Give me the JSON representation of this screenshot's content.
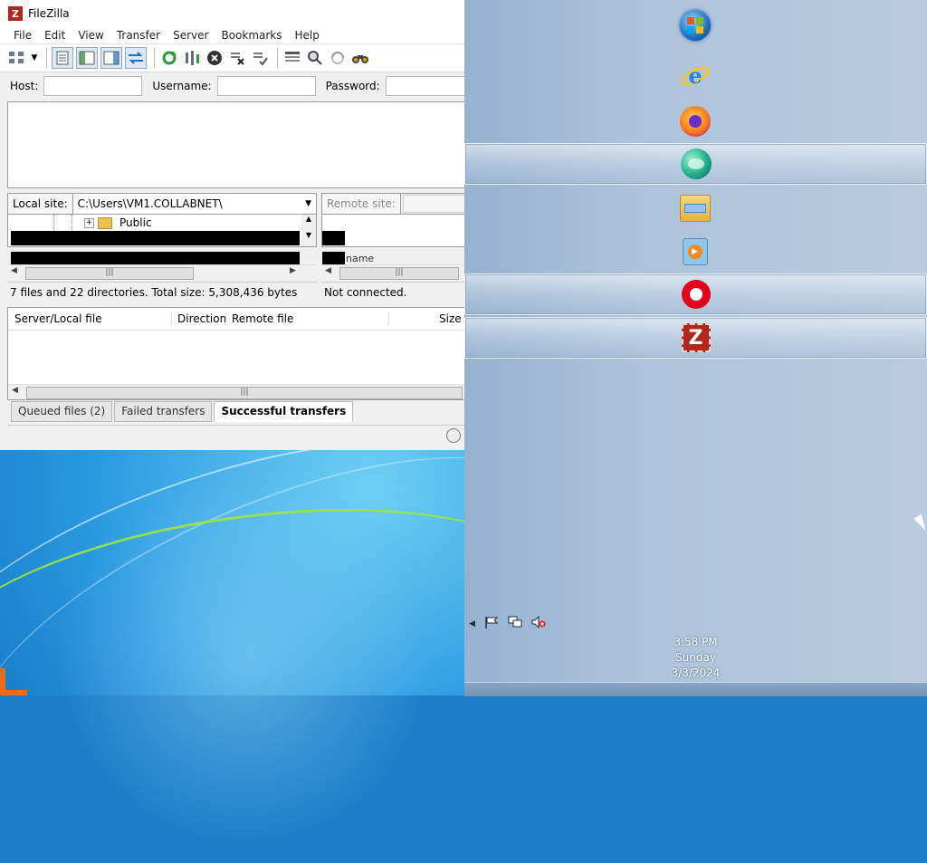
{
  "window": {
    "title": "FileZilla",
    "logo_text": "Z",
    "menu": [
      "File",
      "Edit",
      "View",
      "Transfer",
      "Server",
      "Bookmarks",
      "Help"
    ],
    "quickconnect": {
      "host_label": "Host:",
      "username_label": "Username:",
      "password_label": "Password:",
      "host_value": "",
      "username_value": "",
      "password_value": ""
    },
    "local_site": {
      "label": "Local site:",
      "path": "C:\\Users\\VM1.COLLABNET\\",
      "tree_item": "Public",
      "status": "7 files and 22 directories. Total size: 5,308,436 bytes"
    },
    "remote_site": {
      "label": "Remote site:",
      "column_fragment": "name",
      "status": "Not connected."
    },
    "queue": {
      "columns": [
        "Server/Local file",
        "Direction",
        "Remote file",
        "Size"
      ],
      "tabs": [
        "Queued files (2)",
        "Failed transfers",
        "Successful transfers"
      ],
      "active_tab": "Successful transfers"
    }
  },
  "dock": {
    "items": [
      {
        "name": "start-orb",
        "icon": "windows-logo",
        "active": false
      },
      {
        "name": "internet-explorer",
        "icon": "ie-icon",
        "active": false
      },
      {
        "name": "firefox",
        "icon": "firefox-icon",
        "active": false
      },
      {
        "name": "teal-app",
        "icon": "teal-globe-icon",
        "active": true
      },
      {
        "name": "file-explorer",
        "icon": "folder-icon",
        "active": false
      },
      {
        "name": "media-player",
        "icon": "media-player-icon",
        "active": false
      },
      {
        "name": "red-record-app",
        "icon": "record-icon",
        "active": true
      },
      {
        "name": "filezilla",
        "icon": "filezilla-icon",
        "active": true
      }
    ]
  },
  "tray": {
    "icons": [
      "show-hidden-icons-arrow",
      "action-center-flag-icon",
      "network-icon",
      "volume-muted-icon"
    ]
  },
  "clock": {
    "time": "3:58 PM",
    "day": "Sunday",
    "date": "3/3/2024"
  },
  "colors": {
    "accent_orange": "#f06a1a",
    "filezilla_red": "#b3261e",
    "panel_blue": "#aec4dc"
  }
}
